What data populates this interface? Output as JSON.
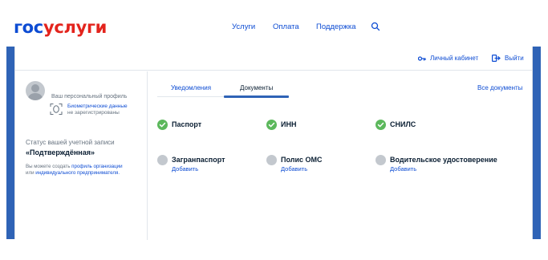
{
  "header": {
    "logo_part1": "гос",
    "logo_part2": "услуги",
    "nav": [
      "Услуги",
      "Оплата",
      "Поддержка"
    ],
    "search_icon": "search-icon"
  },
  "subbar": {
    "cabinet": "Личный кабинет",
    "logout": "Выйти"
  },
  "sidebar": {
    "profile_label": "Ваш персональный профиль",
    "biometric_line1": "Биометрические данные",
    "biometric_line2": "не зарегистрированы",
    "status_label": "Статус вашей учетной записи",
    "status_value": "«Подтверждённая»",
    "hint_text1": "Вы можете создать",
    "hint_link1": "профиль организации",
    "hint_text2": "или",
    "hint_link2": "индивидуального предпринимателя."
  },
  "tabs": {
    "notifications": "Уведомления",
    "documents": "Документы",
    "all_documents": "Все документы"
  },
  "documents": [
    {
      "name": "Паспорт",
      "status": "confirmed",
      "action": ""
    },
    {
      "name": "ИНН",
      "status": "confirmed",
      "action": ""
    },
    {
      "name": "СНИЛС",
      "status": "confirmed",
      "action": ""
    },
    {
      "name": "Загранпаспорт",
      "status": "missing",
      "action": "Добавить"
    },
    {
      "name": "Полис ОМС",
      "status": "missing",
      "action": "Добавить"
    },
    {
      "name": "Водительское удостоверение",
      "status": "missing",
      "action": "Добавить"
    }
  ],
  "colors": {
    "brand_blue": "#0d4cd3",
    "brand_red": "#e3241d",
    "frame_blue": "#2f63b6",
    "success_green": "#5cb85c",
    "inactive_gray": "#c3c8ce"
  }
}
